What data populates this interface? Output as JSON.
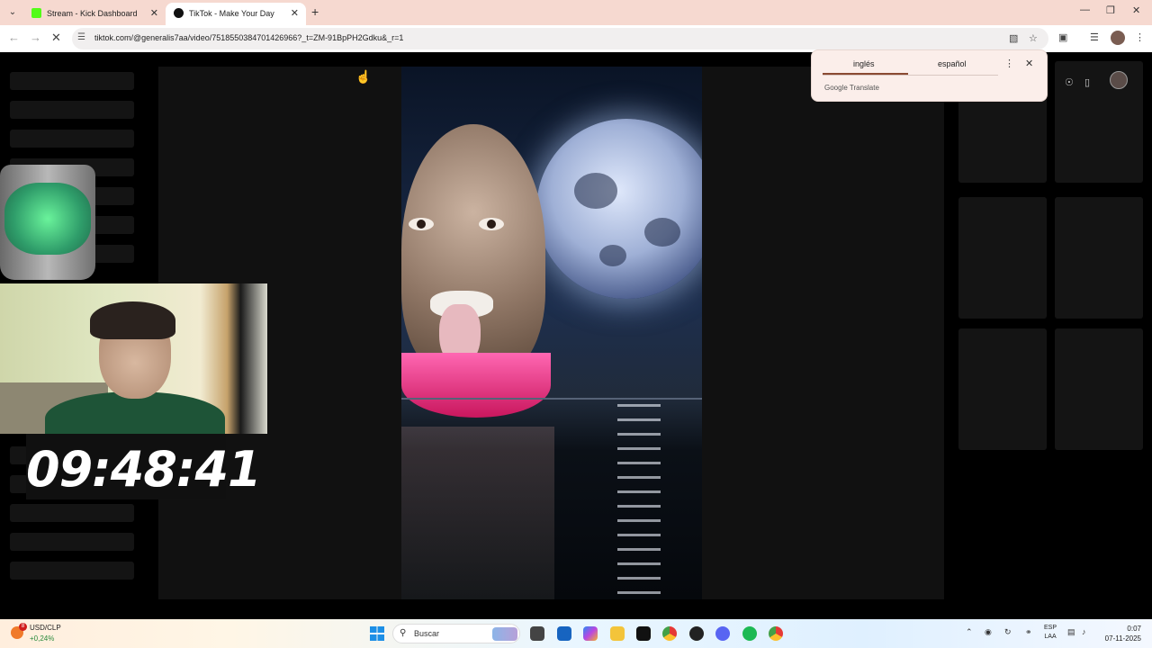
{
  "browser": {
    "tabs": [
      {
        "title": "Stream - Kick Dashboard",
        "active": false
      },
      {
        "title": "TikTok - Make Your Day",
        "active": true
      }
    ],
    "new_tab_label": "+",
    "url": "tiktok.com/@generalis7aa/video/7518550384701426966?_t=ZM-91BpPH2Gdku&_r=1"
  },
  "translate_popup": {
    "source_language": "inglés",
    "target_language": "español",
    "brand": "Google Translate"
  },
  "stream_overlay": {
    "timer": "09:48:41"
  },
  "taskbar": {
    "widget": {
      "name": "USD/CLP",
      "change": "+0,24%",
      "badge": "8"
    },
    "search_placeholder": "Buscar",
    "language": {
      "top": "ESP",
      "bottom": "LAA"
    },
    "clock": {
      "time": "0:07",
      "date": "07-11-2025"
    }
  },
  "colors": {
    "tab_strip": "#f6d9d0",
    "kick_green": "#53fc18",
    "page_bg": "#000000",
    "player_bg": "#111111"
  }
}
